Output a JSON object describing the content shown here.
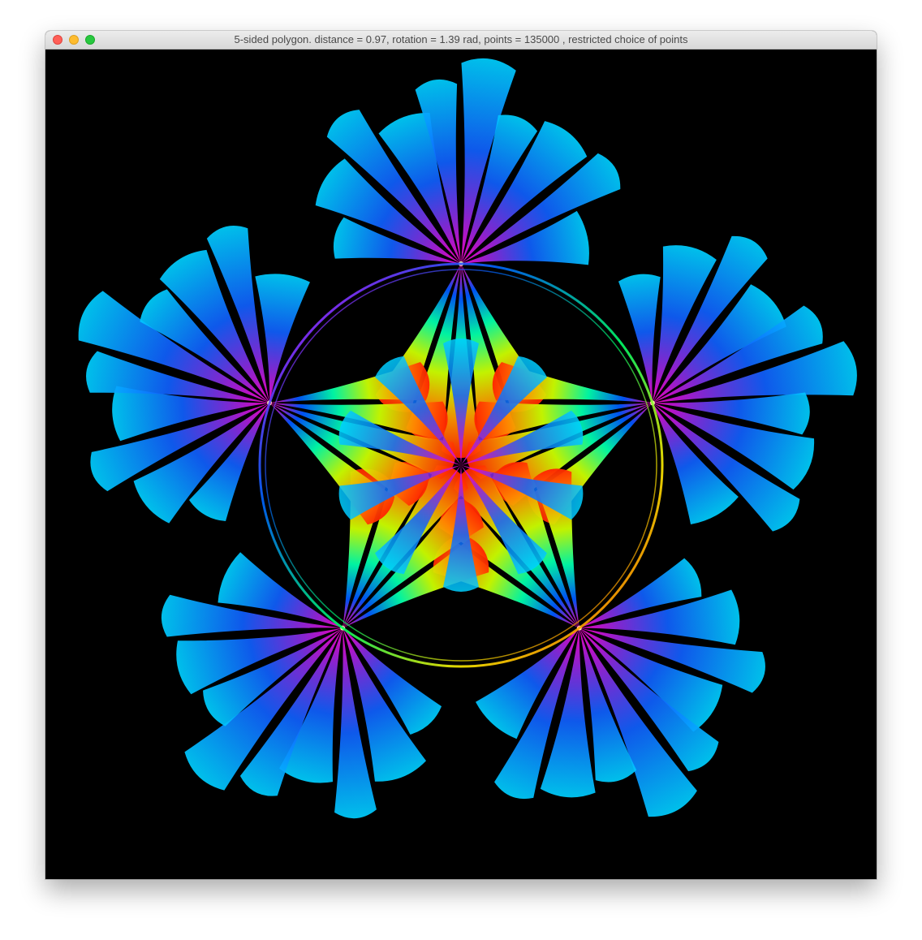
{
  "window": {
    "title": "5-sided polygon. distance = 0.97, rotation = 1.39 rad, points = 135000 , restricted choice of points"
  },
  "traffic_lights": {
    "close": "close-button",
    "minimize": "minimize-button",
    "zoom": "zoom-button"
  },
  "fractal": {
    "background": "#000000",
    "sides": 5,
    "palette": [
      "#ff00ff",
      "#8a2be2",
      "#0066ff",
      "#00ccff",
      "#00ff66",
      "#ffff00",
      "#ff3300"
    ]
  }
}
